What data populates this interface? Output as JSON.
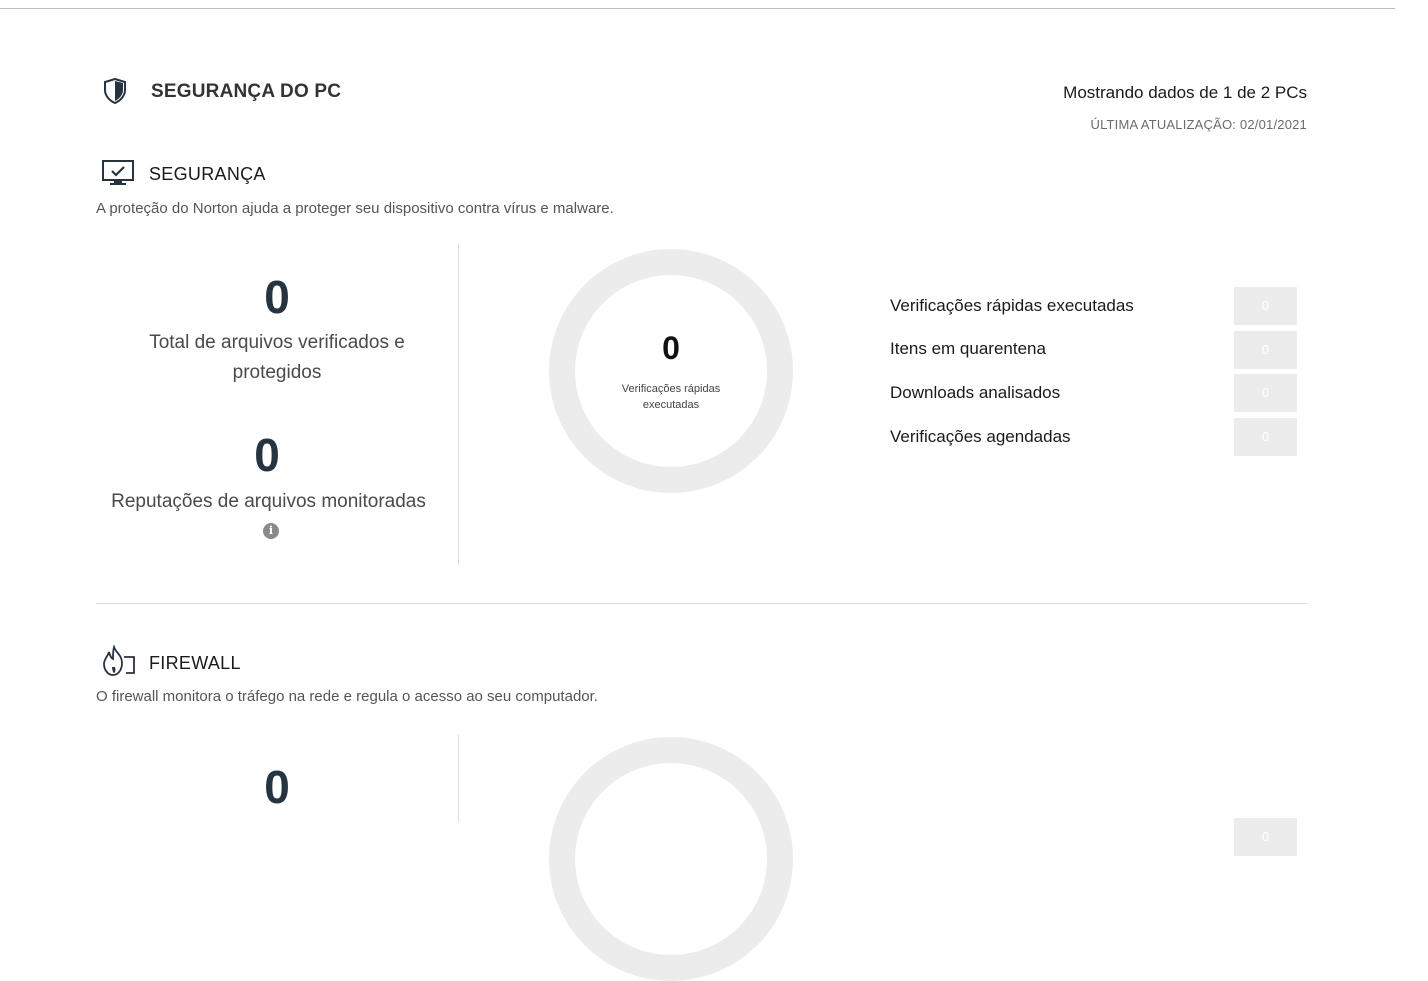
{
  "header": {
    "title": "SEGURANÇA DO PC",
    "showing": "Mostrando dados de 1 de 2 PCs",
    "last_update": "ÚLTIMA ATUALIZAÇÃO: 02/01/2021"
  },
  "security": {
    "title": "SEGURANÇA",
    "description": "A proteção do Norton ajuda a proteger seu dispositivo contra vírus e malware.",
    "files_scanned": {
      "value": "0",
      "label_line1": "Total de arquivos verificados e",
      "label_line2": "protegidos"
    },
    "reputations": {
      "value": "0",
      "label": "Reputações de arquivos monitoradas"
    },
    "ring": {
      "value": "0",
      "label_line1": "Verificações rápidas",
      "label_line2": "executadas"
    },
    "metrics": [
      {
        "label": "Verificações rápidas executadas",
        "value": "0"
      },
      {
        "label": "Itens em quarentena",
        "value": "0"
      },
      {
        "label": "Downloads analisados",
        "value": "0"
      },
      {
        "label": "Verificações agendadas",
        "value": "0"
      }
    ]
  },
  "firewall": {
    "title": "FIREWALL",
    "description": "O firewall monitora o tráfego na rede e regula o acesso ao seu computador.",
    "stat": {
      "value": "0"
    },
    "metric_box": {
      "value": "0"
    }
  },
  "colors": {
    "ring": "#ececec",
    "number": "#263340",
    "divider": "#dcdcdc"
  },
  "icons": [
    "shield-icon",
    "monitor-check-icon",
    "info-icon",
    "firewall-flame-icon"
  ]
}
